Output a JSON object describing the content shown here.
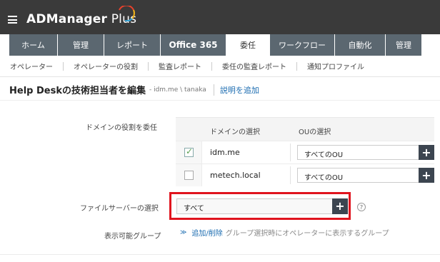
{
  "header": {
    "app_name": "ADManager",
    "app_suffix": " Plus"
  },
  "tabs": [
    {
      "label": "ホーム",
      "active": false
    },
    {
      "label": "管理",
      "active": false
    },
    {
      "label": "レポート",
      "active": false
    },
    {
      "label": "Office 365",
      "active": false
    },
    {
      "label": "委任",
      "active": true
    },
    {
      "label": "ワークフロー",
      "active": false
    },
    {
      "label": "自動化",
      "active": false
    },
    {
      "label": "管理",
      "active": false
    }
  ],
  "subnav": [
    "オペレーター",
    "オペレーターの役割",
    "監査レポート",
    "委任の監査レポート",
    "通知プロファイル"
  ],
  "page": {
    "title": "Help Deskの技術担当者を編集",
    "subtitle": "- idm.me \\ tanaka",
    "add_description": "説明を追加"
  },
  "domain_roles": {
    "label": "ドメインの役割を委任",
    "col_domain": "ドメインの選択",
    "col_ou": "OUの選択",
    "rows": [
      {
        "domain": "idm.me",
        "checked": true,
        "ou": "すべてのOU"
      },
      {
        "domain": "metech.local",
        "checked": false,
        "ou": "すべてのOU"
      }
    ]
  },
  "file_server": {
    "label": "ファイルサーバーの選択",
    "value": "すべて"
  },
  "groups": {
    "label": "表示可能グループ",
    "link": "追加/削除",
    "description": "グループ選択時にオペレーターに表示するグループ"
  },
  "colors": {
    "topbar": "#3a3a3a",
    "tab": "#5b6770",
    "accent_link": "#1a6bb0",
    "highlight": "#e0141e"
  }
}
